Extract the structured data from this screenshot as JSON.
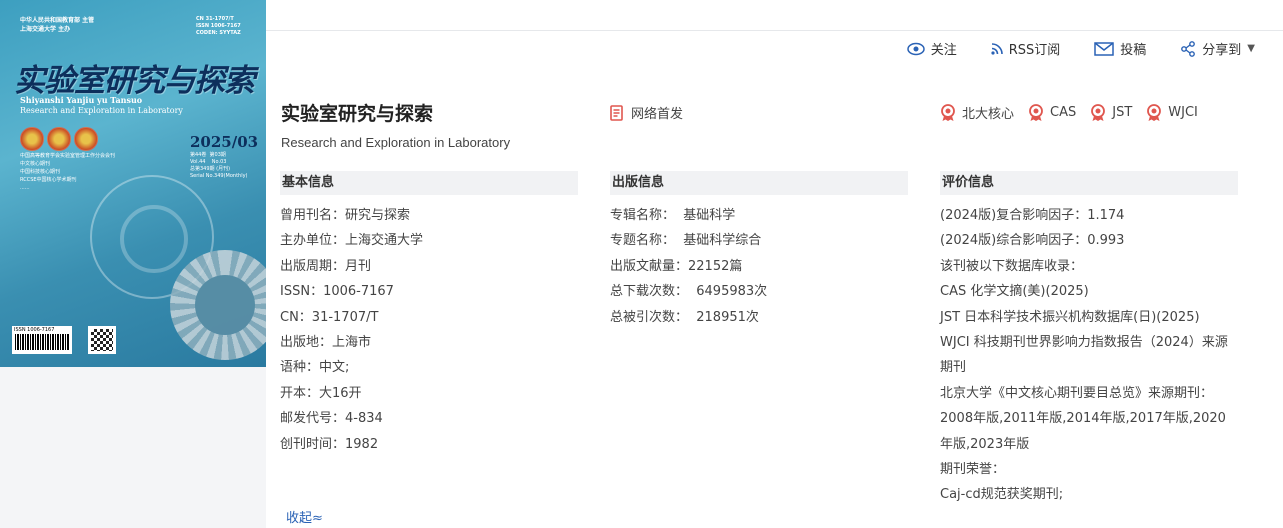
{
  "cover": {
    "publisher_lines": "中华人民共和国教育部 主管\n上海交通大学 主办",
    "codes": "CN 31-1707/T\nISSN 1006-7167\nCODEN: SYYTAZ",
    "cn_title": "实验室研究与探索",
    "pinyin": "Shiyanshi Yanjiu yu Tansuo",
    "en_title": "Research and Exploration in Laboratory",
    "issue": "2025/03",
    "issue_sub": "第44卷  第03期\nVol.44    No.03\n总第349期 (月刊)\nSerial No.349(Monthly)",
    "index_list": "中国高等教育学会实验室管理工作分会会刊\n中文核心期刊\n中国科技核心期刊\nRCCSE中国核心学术期刊\n......",
    "issn_text": "ISSN 1006-7167"
  },
  "actions": {
    "follow": "关注",
    "rss": "RSS订阅",
    "submit": "投稿",
    "share": "分享到"
  },
  "journal": {
    "title": "实验室研究与探索",
    "subtitle": "Research and Exploration in Laboratory",
    "first_pub": "网络首发",
    "tags": [
      "北大核心",
      "CAS",
      "JST",
      "WJCI"
    ]
  },
  "basic": {
    "heading": "基本信息",
    "rows": [
      "曾用刊名：研究与探索",
      "主办单位：上海交通大学",
      "出版周期：月刊",
      "ISSN：1006-7167",
      "CN：31-1707/T",
      "出版地：上海市",
      "语种：中文;",
      "开本：大16开",
      "邮发代号：4-834",
      "创刊时间：1982"
    ]
  },
  "publish": {
    "heading": "出版信息",
    "rows": [
      "专辑名称：  基础科学",
      "专题名称：  基础科学综合",
      "出版文献量：22152篇",
      "总下载次数：  6495983次",
      "总被引次数：  218951次"
    ]
  },
  "evaluation": {
    "heading": "评价信息",
    "rows": [
      "(2024版)复合影响因子：1.174",
      "(2024版)综合影响因子：0.993",
      "该刊被以下数据库收录：",
      "CAS 化学文摘(美)(2025)",
      "JST 日本科学技术振兴机构数据库(日)(2025)",
      "WJCI 科技期刊世界影响力指数报告（2024）来源期刊",
      "北京大学《中文核心期刊要目总览》来源期刊：",
      "2008年版,2011年版,2014年版,2017年版,2020年版,2023年版",
      "期刊荣誉：",
      "Caj-cd规范获奖期刊;"
    ]
  },
  "collapse_label": "收起≈",
  "colors": {
    "accent": "#2a62b5",
    "tag_red": "#e0574f"
  }
}
